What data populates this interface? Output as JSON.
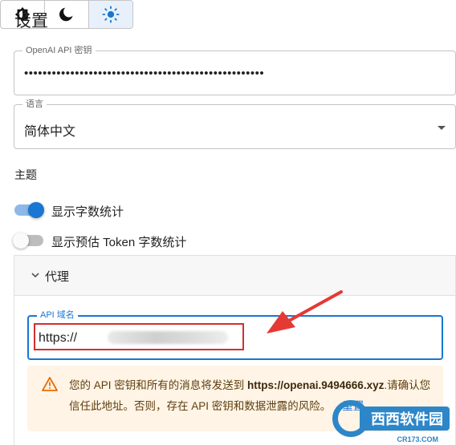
{
  "title": "设置",
  "api_key": {
    "legend": "OpenAI API 密钥",
    "masked_value": "••••••••••••••••••••••••••••••••••••••••••••••••••••"
  },
  "language": {
    "legend": "语言",
    "value": "简体中文",
    "icon": "chevron-down-icon"
  },
  "theme": {
    "label": "主题",
    "options": [
      {
        "icon": "brightness-auto-icon",
        "selected": false
      },
      {
        "icon": "moon-icon",
        "selected": false
      },
      {
        "icon": "sun-icon",
        "selected": true
      }
    ],
    "accent": "#1976d2"
  },
  "switches": [
    {
      "label": "显示字数统计",
      "on": true
    },
    {
      "label": "显示预估 Token 字数统计",
      "on": false
    }
  ],
  "proxy": {
    "label": "代理",
    "domain_legend": "API 域名",
    "domain_value": "https://"
  },
  "warning": {
    "text_before": "您的 API 密钥和所有的消息将发送到 ",
    "domain": "https://openai.9494666.xyz",
    "text_after": ".请确认您信任此地址。否则，存在 API 密钥和数据泄露的风险。",
    "reset_label": "重置"
  },
  "watermark": {
    "text": "西西软件园",
    "sub": "CR173.COM"
  }
}
